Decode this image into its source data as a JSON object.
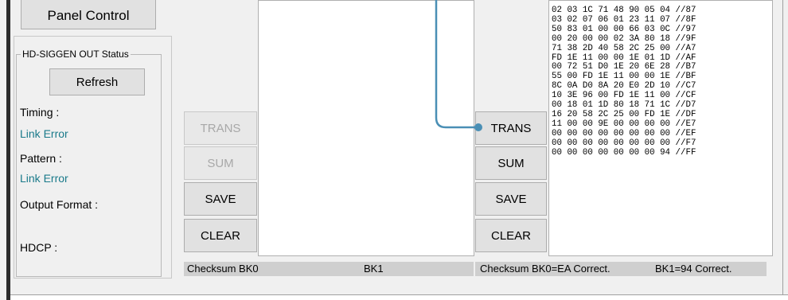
{
  "panel_control": {
    "label": "Panel Control"
  },
  "status_group": {
    "title": "HD-SIGGEN OUT Status",
    "refresh_label": "Refresh",
    "timing_label": "Timing :",
    "timing_value": "Link Error",
    "pattern_label": "Pattern :",
    "pattern_value": "Link Error",
    "output_format_label": "Output Format :",
    "hdcp_label": "HDCP :"
  },
  "left_edid": {
    "buttons": {
      "trans": "TRANS",
      "sum": "SUM",
      "save": "SAVE",
      "clear": "CLEAR"
    },
    "status": {
      "checksum_bk0": "Checksum BK0",
      "bk1": "BK1"
    }
  },
  "right_edid": {
    "buttons": {
      "trans": "TRANS",
      "sum": "SUM",
      "save": "SAVE",
      "clear": "CLEAR"
    },
    "status": {
      "checksum_bk0": "Checksum BK0=EA Correct.",
      "bk1": "BK1=94 Correct."
    },
    "hex_lines": [
      "02 03 1C 71 48 90 05 04 //87",
      "03 02 07 06 01 23 11 07 //8F",
      "50 83 01 00 00 66 03 0C //97",
      "00 20 00 00 02 3A 80 18 //9F",
      "71 38 2D 40 58 2C 25 00 //A7",
      "FD 1E 11 00 00 1E 01 1D //AF",
      "00 72 51 D0 1E 20 6E 28 //B7",
      "55 00 FD 1E 11 00 00 1E //BF",
      "8C 0A D0 8A 20 E0 2D 10 //C7",
      "10 3E 96 00 FD 1E 11 00 //CF",
      "00 18 01 1D 80 18 71 1C //D7",
      "16 20 58 2C 25 00 FD 1E //DF",
      "11 00 00 9E 00 00 00 00 //E7",
      "00 00 00 00 00 00 00 00 //EF",
      "00 00 00 00 00 00 00 00 //F7",
      "00 00 00 00 00 00 00 94 //FF"
    ]
  },
  "colors": {
    "link_error": "#1a7a8a",
    "callout": "#4a8fb5"
  }
}
